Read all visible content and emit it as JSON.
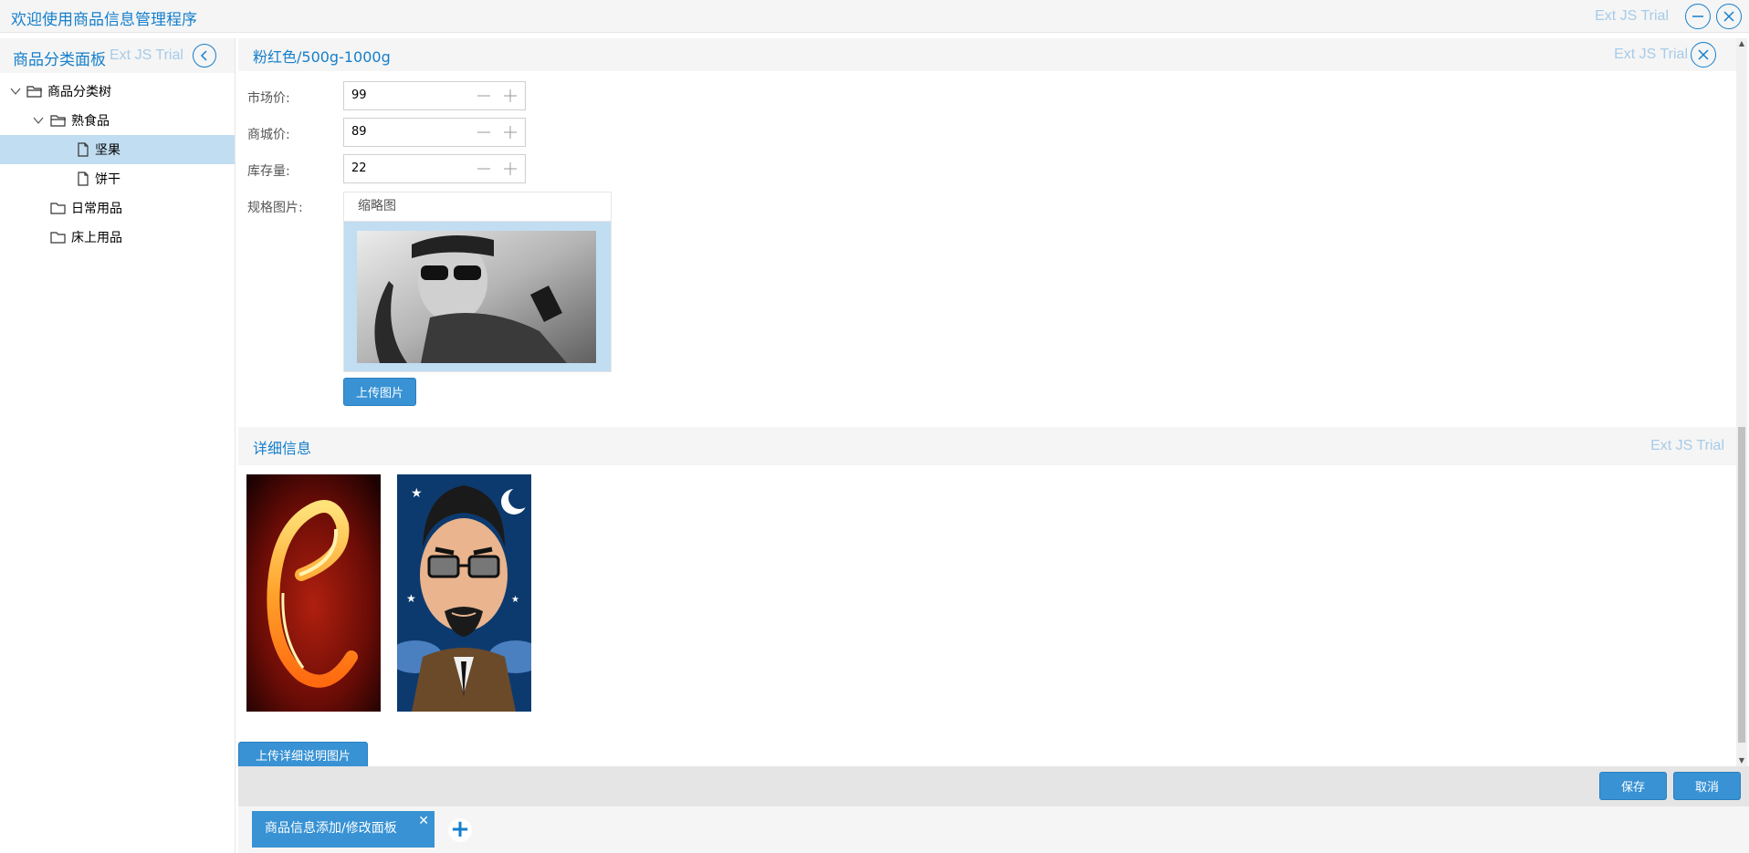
{
  "app": {
    "title": "欢迎使用商品信息管理程序",
    "trial_text": "Ext JS Trial"
  },
  "left_panel": {
    "title": "商品分类面板",
    "trial_text": "Ext JS Trial",
    "tree": [
      {
        "label": "商品分类树",
        "type": "folder",
        "expanded": true,
        "level": 0
      },
      {
        "label": "熟食品",
        "type": "folder",
        "expanded": true,
        "level": 1
      },
      {
        "label": "坚果",
        "type": "leaf",
        "selected": true,
        "level": 2
      },
      {
        "label": "饼干",
        "type": "leaf",
        "level": 2
      },
      {
        "label": "日常用品",
        "type": "folder",
        "level": 1
      },
      {
        "label": "床上用品",
        "type": "folder",
        "level": 1
      }
    ]
  },
  "spec_panel": {
    "title": "粉红色/500g-1000g",
    "trial_text": "Ext JS Trial",
    "fields": {
      "market_price": {
        "label": "市场价:",
        "value": "99"
      },
      "mall_price": {
        "label": "商城价:",
        "value": "89"
      },
      "stock": {
        "label": "库存量:",
        "value": "22"
      }
    },
    "image_label": "规格图片:",
    "image_column": "缩略图",
    "upload_button": "上传图片"
  },
  "detail_panel": {
    "title": "详细信息",
    "trial_text": "Ext JS Trial",
    "upload_button": "上传详细说明图片"
  },
  "actions": {
    "save": "保存",
    "cancel": "取消"
  },
  "tabs": [
    {
      "label": "商品信息添加/修改面板",
      "close": "✕"
    }
  ],
  "add_tab": "+",
  "colors": {
    "accent": "#157fcc",
    "button": "#3892d4",
    "selection": "#c1ddf1",
    "trial": "#a7cbe8"
  }
}
